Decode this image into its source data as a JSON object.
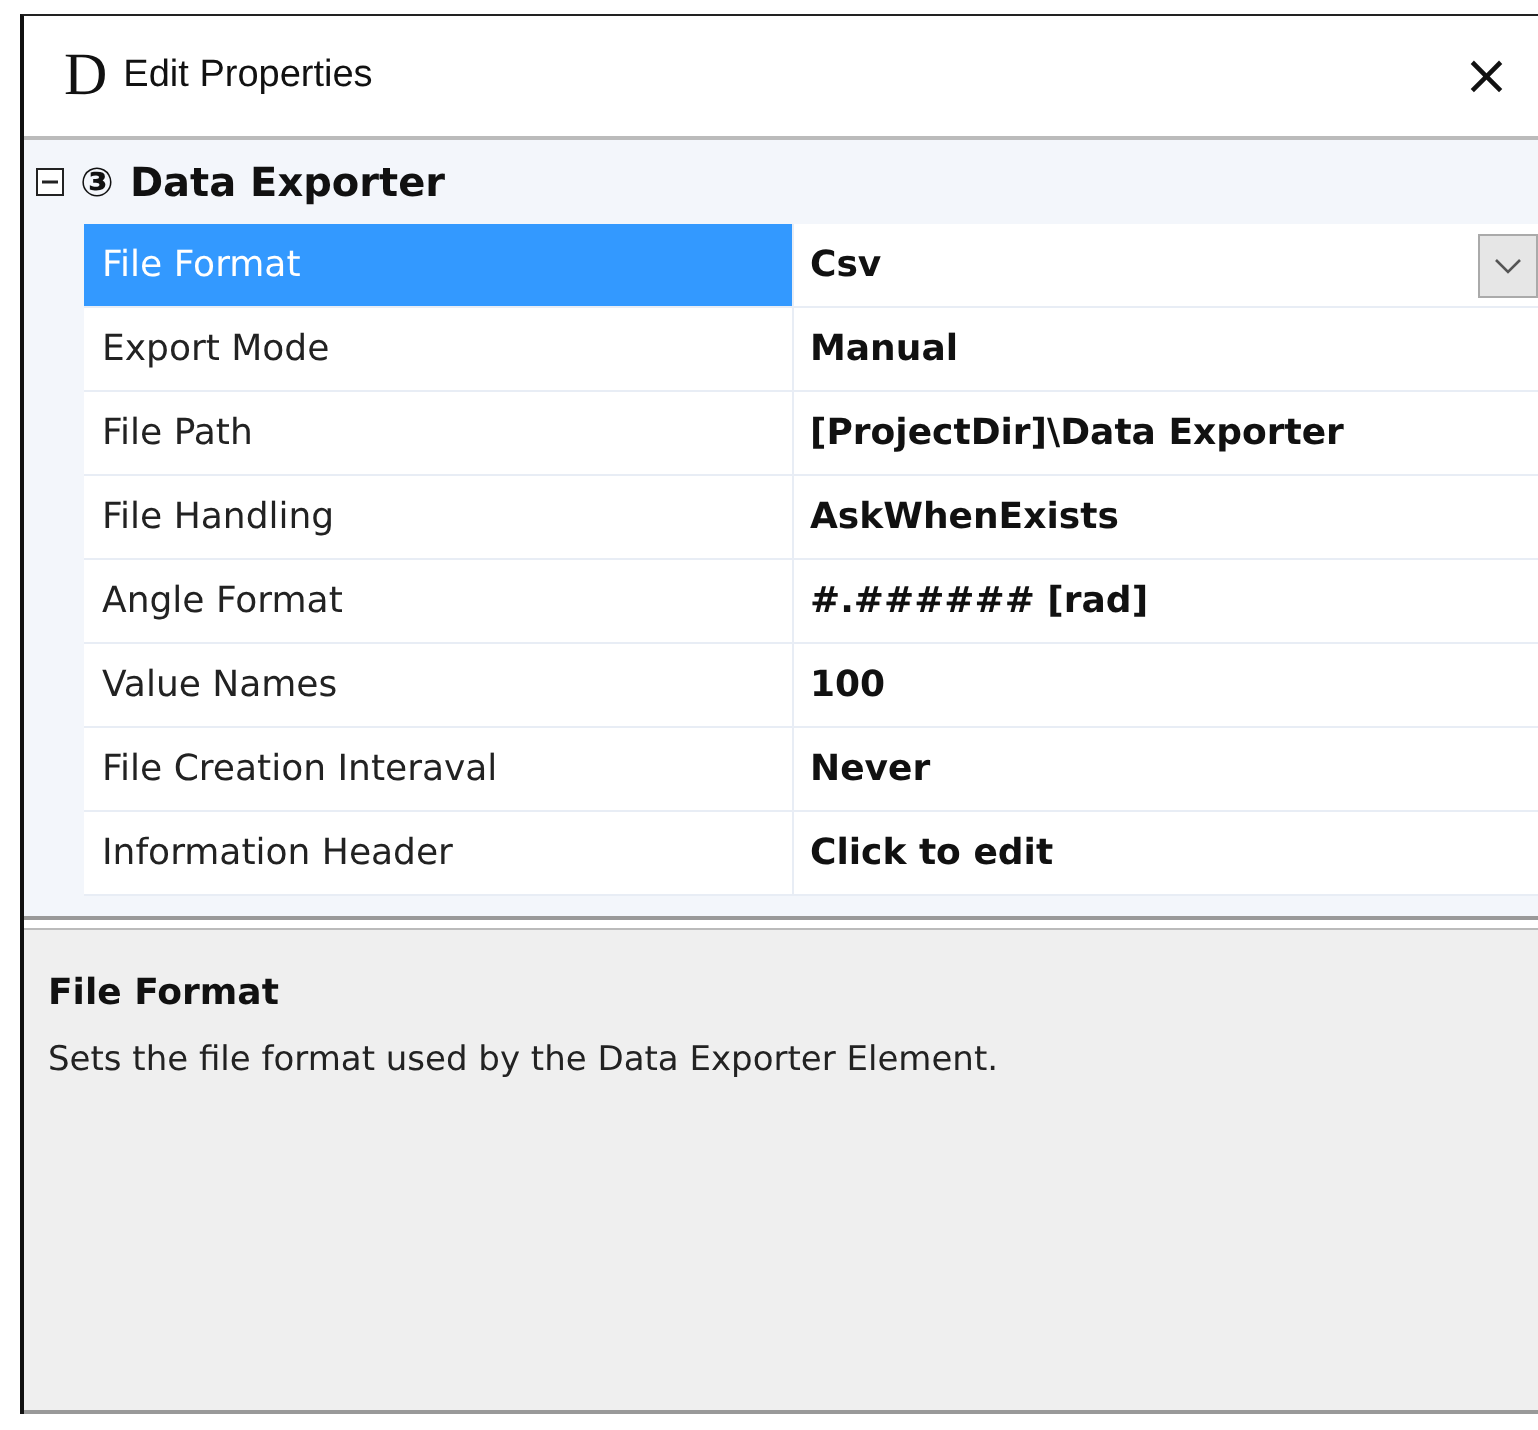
{
  "window": {
    "app_icon": "D",
    "title": "Edit Properties",
    "close": "×"
  },
  "category": {
    "expanded": true,
    "icon": "③",
    "name": "Data Exporter"
  },
  "properties": [
    {
      "name": "File Format",
      "value": "Csv",
      "selected": true,
      "dropdown": true
    },
    {
      "name": "Export Mode",
      "value": "Manual",
      "selected": false,
      "dropdown": false
    },
    {
      "name": "File Path",
      "value": "[ProjectDir]\\Data Exporter",
      "selected": false,
      "dropdown": false
    },
    {
      "name": "File Handling",
      "value": "AskWhenExists",
      "selected": false,
      "dropdown": false
    },
    {
      "name": "Angle Format",
      "value": "#.###### [rad]",
      "selected": false,
      "dropdown": false
    },
    {
      "name": "Value Names",
      "value": "100",
      "selected": false,
      "dropdown": false
    },
    {
      "name": "File Creation Interaval",
      "value": "Never",
      "selected": false,
      "dropdown": false
    },
    {
      "name": "Information Header",
      "value": "Click to edit",
      "selected": false,
      "dropdown": false
    }
  ],
  "description": {
    "title": "File Format",
    "text": "Sets the file format used by the Data Exporter Element."
  }
}
